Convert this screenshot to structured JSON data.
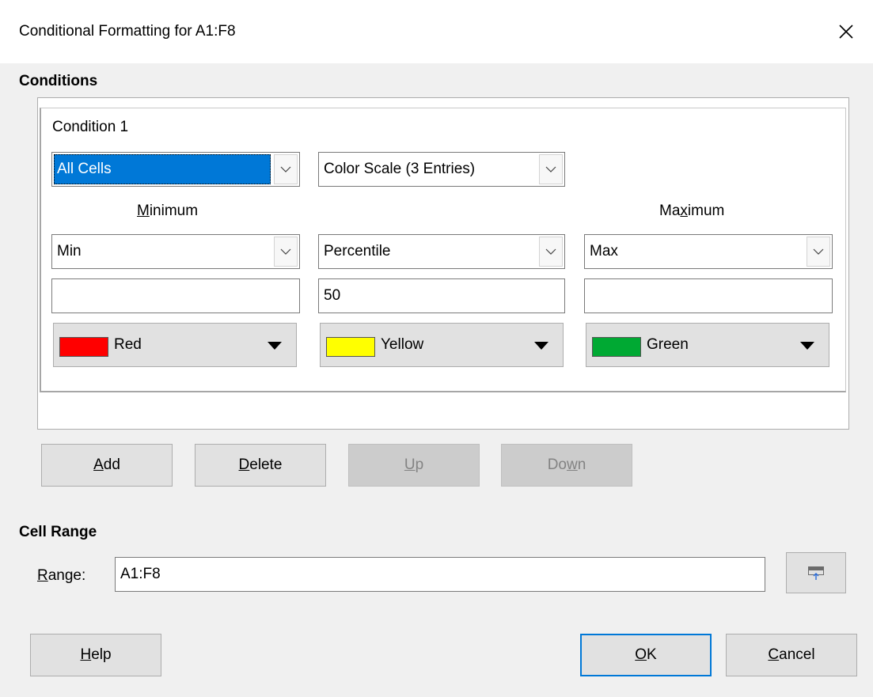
{
  "dialog": {
    "title": "Conditional Formatting for A1:F8"
  },
  "conditions": {
    "section_title": "Conditions",
    "condition_label": "Condition 1",
    "applies_to": "All Cells",
    "type": "Color Scale (3 Entries)",
    "minimum_caption": {
      "pre": "",
      "key": "M",
      "post": "inimum"
    },
    "maximum_caption": {
      "pre": "Ma",
      "key": "x",
      "post": "imum"
    },
    "entries": [
      {
        "type": "Min",
        "value": "",
        "color_name": "Red",
        "color": "#ff0000"
      },
      {
        "type": "Percentile",
        "value": "50",
        "color_name": "Yellow",
        "color": "#ffff00"
      },
      {
        "type": "Max",
        "value": "",
        "color_name": "Green",
        "color": "#00a933"
      }
    ]
  },
  "buttons": {
    "add": {
      "key": "A",
      "rest": "dd"
    },
    "delete": {
      "key": "D",
      "rest": "elete"
    },
    "up": {
      "key": "U",
      "rest": "p"
    },
    "down": {
      "pre": "Do",
      "key": "w",
      "rest": "n"
    },
    "help": {
      "key": "H",
      "rest": "elp"
    },
    "ok": {
      "key": "O",
      "rest": "K"
    },
    "cancel": {
      "key": "C",
      "rest": "ancel"
    }
  },
  "cell_range": {
    "section_title": "Cell Range",
    "label": {
      "key": "R",
      "rest": "ange:"
    },
    "value": "A1:F8"
  },
  "colors": {
    "accent": "#0078d7",
    "button_face": "#e1e1e1",
    "disabled_face": "#cccccc"
  }
}
